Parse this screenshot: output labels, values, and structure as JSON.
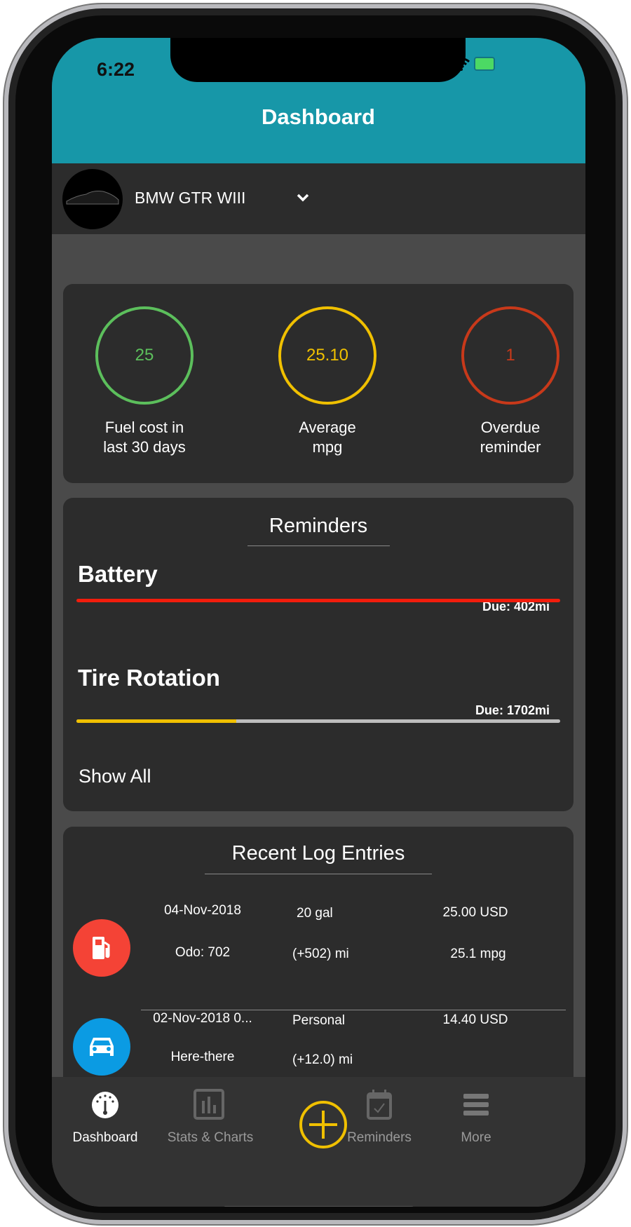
{
  "status_bar": {
    "time": "6:22"
  },
  "header": {
    "title": "Dashboard",
    "color": "#1797a8"
  },
  "vehicle": {
    "name": "BMW GTR WIII"
  },
  "summary": [
    {
      "value": "25",
      "label_line1": "Fuel cost in",
      "label_line2": "last 30 days",
      "color": "#5cbf5c"
    },
    {
      "value": "25.10",
      "label_line1": "Average",
      "label_line2": "mpg",
      "color": "#f0c000"
    },
    {
      "value": "1",
      "label_line1": "Overdue",
      "label_line2": "reminder",
      "color": "#c8391a"
    }
  ],
  "reminders": {
    "title": "Reminders",
    "items": [
      {
        "name": "Battery",
        "due": "Due: 402mi",
        "progress": 1.0,
        "color": "#f21d0c"
      },
      {
        "name": "Tire Rotation",
        "due": "Due: 1702mi",
        "progress": 0.33,
        "color": "#f0c000"
      }
    ],
    "show_all": "Show All"
  },
  "log": {
    "title": "Recent Log Entries",
    "entries": [
      {
        "icon": "fuel-pump-icon",
        "color": "#f44336",
        "date": "04-Nov-2018",
        "sub": "Odo: 702",
        "c2a": "20 gal",
        "c2b": "(+502) mi",
        "c3a": "25.00  USD",
        "c3b": "25.1 mpg"
      },
      {
        "icon": "car-icon",
        "color": "#0b9be3",
        "date": "02-Nov-2018 0...",
        "sub": "Here-there",
        "c2a": "Personal",
        "c2b": "(+12.0) mi",
        "c3a": "14.40  USD",
        "c3b": ""
      }
    ]
  },
  "tabs": [
    {
      "label": "Dashboard",
      "active": true
    },
    {
      "label": "Stats & Charts"
    },
    {
      "label": ""
    },
    {
      "label": "Reminders"
    },
    {
      "label": "More"
    }
  ]
}
